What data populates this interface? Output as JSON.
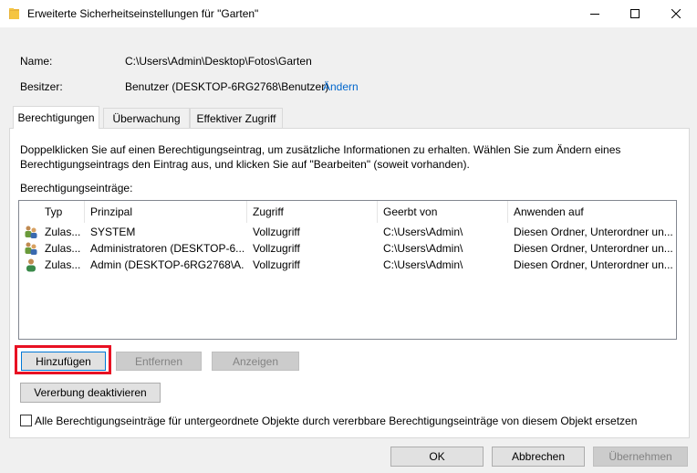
{
  "window": {
    "title": "Erweiterte Sicherheitseinstellungen für \"Garten\""
  },
  "fields": {
    "name_label": "Name:",
    "name_value": "C:\\Users\\Admin\\Desktop\\Fotos\\Garten",
    "owner_label": "Besitzer:",
    "owner_value": "Benutzer (DESKTOP-6RG2768\\Benutzer)",
    "owner_change_link": "Ändern"
  },
  "tabs": [
    {
      "label": "Berechtigungen",
      "active": true
    },
    {
      "label": "Überwachung",
      "active": false
    },
    {
      "label": "Effektiver Zugriff",
      "active": false
    }
  ],
  "permissions": {
    "instructions_line1": "Doppelklicken Sie auf einen Berechtigungseintrag, um zusätzliche Informationen zu erhalten. Wählen Sie zum Ändern eines",
    "instructions_line2": "Berechtigungseintrags den Eintrag aus, und klicken Sie auf \"Bearbeiten\" (soweit vorhanden).",
    "entries_label": "Berechtigungseinträge:",
    "columns": [
      "Typ",
      "Prinzipal",
      "Zugriff",
      "Geerbt von",
      "Anwenden auf"
    ],
    "rows": [
      {
        "icon": "group-users-icon",
        "type": "Zulas...",
        "principal": "SYSTEM",
        "access": "Vollzugriff",
        "inherited": "C:\\Users\\Admin\\",
        "applies": "Diesen Ordner, Unterordner un..."
      },
      {
        "icon": "group-users-icon",
        "type": "Zulas...",
        "principal": "Administratoren (DESKTOP-6...",
        "access": "Vollzugriff",
        "inherited": "C:\\Users\\Admin\\",
        "applies": "Diesen Ordner, Unterordner un..."
      },
      {
        "icon": "user-icon",
        "type": "Zulas...",
        "principal": "Admin (DESKTOP-6RG2768\\A...",
        "access": "Vollzugriff",
        "inherited": "C:\\Users\\Admin\\",
        "applies": "Diesen Ordner, Unterordner un..."
      }
    ],
    "add_button": "Hinzufügen",
    "remove_button": "Entfernen",
    "view_button": "Anzeigen",
    "disable_inheritance_button": "Vererbung deaktivieren",
    "replace_checkbox_label": "Alle Berechtigungseinträge für untergeordnete Objekte durch vererbbare Berechtigungseinträge von diesem Objekt ersetzen"
  },
  "footer": {
    "ok": "OK",
    "cancel": "Abbrechen",
    "apply": "Übernehmen"
  },
  "colors": {
    "highlight": "#e81123",
    "link": "#0066cc",
    "folder": "#f5c542"
  }
}
